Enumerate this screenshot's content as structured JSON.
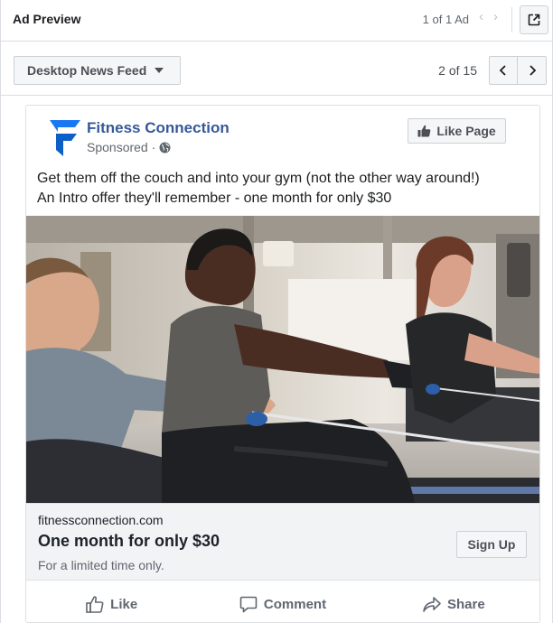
{
  "header": {
    "title": "Ad Preview",
    "ad_count": "1 of 1 Ad",
    "prev_icon": "chevron-left-icon",
    "next_icon": "chevron-right-icon",
    "open_icon": "external-link-icon"
  },
  "toolbar": {
    "placement": "Desktop News Feed",
    "page_count": "2 of 15"
  },
  "post": {
    "page_name": "Fitness Connection",
    "sponsored": "Sponsored ·",
    "like_page_label": "Like Page",
    "text_line1": "Get them off the couch and into your gym (not the other way around!)",
    "text_line2": "An Intro offer they'll remember - one month for only $30",
    "link": {
      "domain": "fitnessconnection.com",
      "headline": "One month for only $30",
      "description": "For a limited time only.",
      "cta": "Sign Up"
    },
    "actions": [
      {
        "label": "Like",
        "icon": "thumbs-up-outline-icon"
      },
      {
        "label": "Comment",
        "icon": "comment-icon"
      },
      {
        "label": "Share",
        "icon": "share-icon"
      }
    ]
  },
  "colors": {
    "brand_blue": "#365899",
    "logo_blue": "#1877f2",
    "border": "#dadde1",
    "button_bg": "#f5f6f7"
  }
}
